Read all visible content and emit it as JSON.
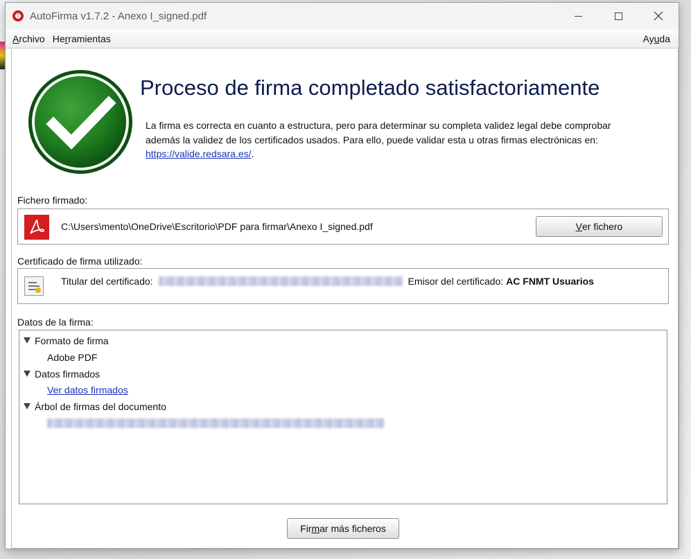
{
  "window": {
    "title": "AutoFirma v1.7.2 - Anexo I_signed.pdf",
    "controls": {
      "minimize_icon": "minimize-icon",
      "maximize_icon": "maximize-icon",
      "close_icon": "close-icon"
    }
  },
  "menu": {
    "archivo": {
      "pre": "",
      "key": "A",
      "post": "rchivo"
    },
    "herramientas": {
      "pre": "He",
      "key": "r",
      "post": "ramientas"
    },
    "ayuda": {
      "pre": "Ay",
      "key": "u",
      "post": "da"
    }
  },
  "result": {
    "icon": "check-circle-icon",
    "headline": "Proceso de firma completado satisfactoriamente",
    "description": "La firma es correcta en cuanto a estructura, pero para determinar su completa validez legal debe comprobar además la validez de los certificados usados. Para ello, puede validar esta u otras firmas electrónicas en:",
    "link": "https://valide.redsara.es/",
    "link_suffix": "."
  },
  "signed_file": {
    "label": "Fichero firmado:",
    "icon": "pdf-icon",
    "path": "C:\\Users\\mento\\OneDrive\\Escritorio\\PDF para firmar\\Anexo I_signed.pdf",
    "button": {
      "pre": "",
      "key": "V",
      "post": "er fichero"
    }
  },
  "certificate": {
    "label": "Certificado de firma utilizado:",
    "icon": "certificate-icon",
    "holder_label": "Titular del certificado:",
    "issuer_label": "Emisor del certificado:",
    "issuer_value": "AC FNMT Usuarios"
  },
  "signature_data": {
    "label": "Datos de la firma:",
    "format_node": "Formato de firma",
    "format_value": "Adobe PDF",
    "signed_data_node": "Datos firmados",
    "signed_data_link": "Ver datos firmados",
    "tree_node": "Árbol de firmas del documento"
  },
  "footer": {
    "button": {
      "pre": "Fir",
      "key": "m",
      "post": "ar más ficheros"
    }
  },
  "colors": {
    "headline": "#0d1c4c",
    "link": "#1a33b5",
    "check_green": "#1f7d1f",
    "pdf_red": "#d51d22",
    "app_icon_red": "#c8201f"
  }
}
